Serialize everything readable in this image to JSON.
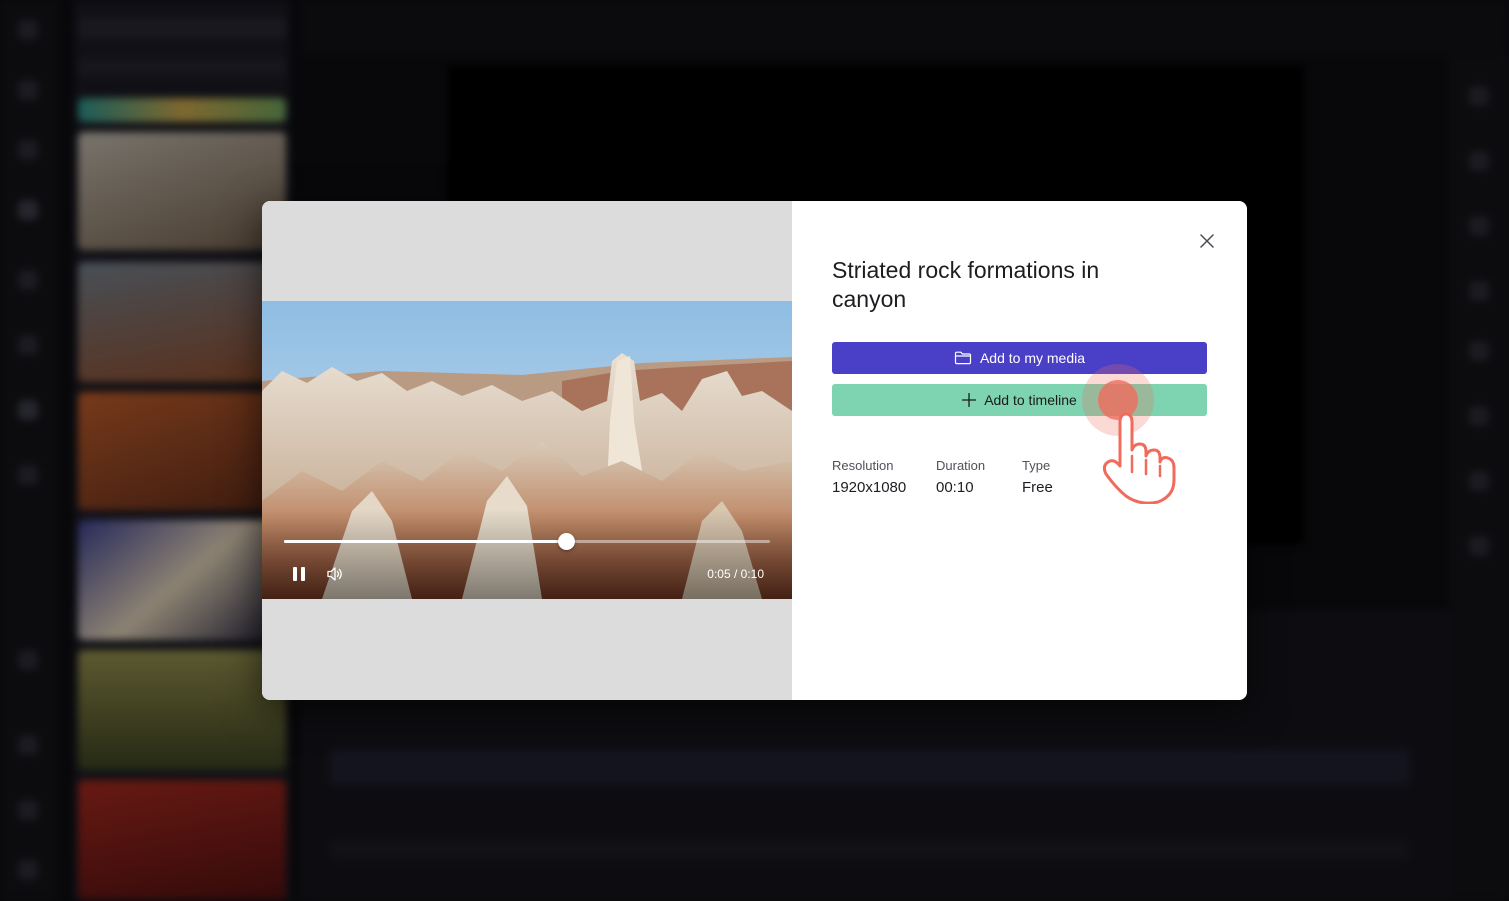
{
  "dialog": {
    "title": "Striated rock formations in canyon",
    "add_media_label": "Add to my media",
    "add_timeline_label": "Add to timeline",
    "close_icon": "close-icon",
    "folder_icon": "folder-icon",
    "plus_icon": "plus-icon"
  },
  "player": {
    "current_time": "0:05",
    "duration": "0:10",
    "time_display": "0:05 / 0:10",
    "progress_fraction": 0.58,
    "pause_icon": "pause-icon",
    "volume_icon": "volume-icon"
  },
  "details": [
    {
      "key": "Resolution",
      "value": "1920x1080"
    },
    {
      "key": "Duration",
      "value": "00:10"
    },
    {
      "key": "Type",
      "value": "Free"
    }
  ],
  "colors": {
    "primary_button": "#4a40c8",
    "timeline_button": "#7ed3b1",
    "backdrop": "#0d0d11",
    "click_indicator": "#f06b5c"
  }
}
